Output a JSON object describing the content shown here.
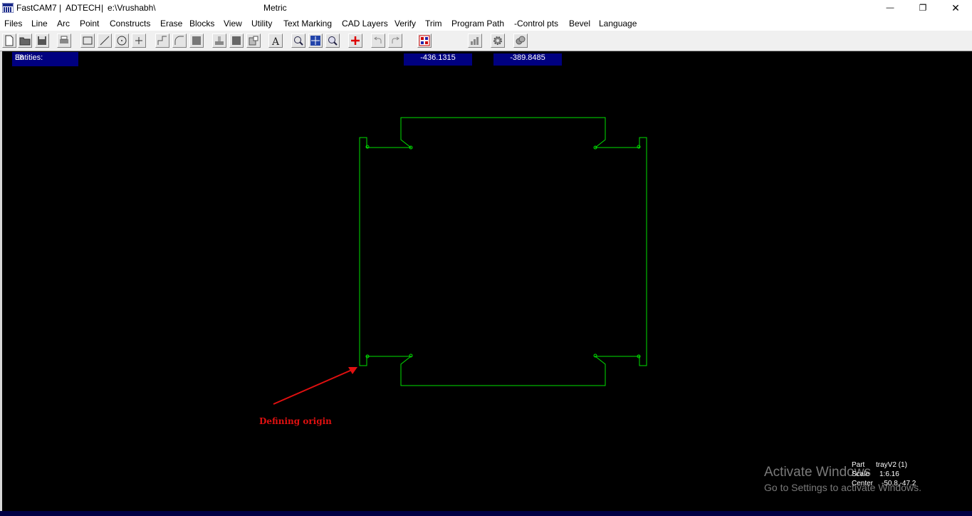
{
  "titlebar": {
    "app_name": "FastCAM7",
    "separator": "|",
    "company": "ADTECH",
    "path": "e:\\Vrushabh\\",
    "units": "Metric",
    "minimize_glyph": "—",
    "restore_glyph": "❐",
    "close_glyph": "✕"
  },
  "menu": [
    "Files",
    "Line",
    "Arc",
    "Point",
    "Constructs",
    "Erase",
    "Blocks",
    "View",
    "Utility",
    "Text Marking",
    "CAD Layers",
    "Verify",
    "Trim",
    "Program Path",
    "-Control pts",
    "Bevel",
    "Language"
  ],
  "toolbar": {
    "buttons": [
      "new-file-icon",
      "open-folder-icon",
      "save-icon",
      "print-icon",
      "rectangle-icon",
      "line-icon",
      "circle-icon",
      "point-icon",
      "step-icon",
      "arc-corner-icon",
      "filled-block-icon",
      "stamp-icon",
      "erase-block-icon",
      "insert-icon",
      "text-icon",
      "zoom-window-icon",
      "zoom-extents-icon",
      "zoom-in-icon",
      "add-cross-icon",
      "undo-icon",
      "redo-icon",
      "calculator-icon",
      "chart-icon",
      "gear-icon",
      "copy-gear-icon"
    ]
  },
  "status": {
    "entities_label": "Entities:",
    "entities_count": "38",
    "coord_x": "-436.1315",
    "coord_y": "-389.8485"
  },
  "annotation": {
    "label": "Defining origin",
    "color": "#e01010"
  },
  "part_info": {
    "part_label": "Part",
    "part_value": "trayV2 (1)",
    "scale_label": "Scale",
    "scale_value": "1:6.16",
    "center_label": "Center",
    "center_value": "-50.8,-47.2"
  },
  "watermark": {
    "title": "Activate Windows",
    "subtitle": "Go to Settings to activate Windows."
  },
  "colors": {
    "geometry": "#00e000",
    "status_box": "#000080",
    "canvas": "#000000"
  }
}
